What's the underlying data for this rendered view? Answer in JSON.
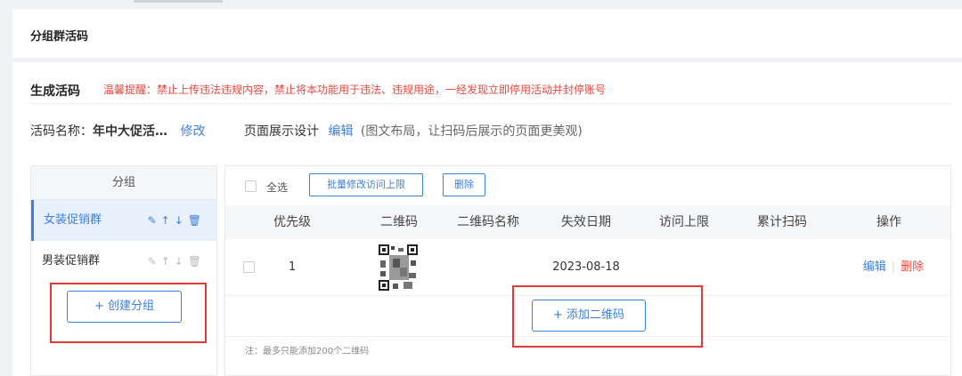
{
  "page": {
    "title": "分组群活码"
  },
  "section": {
    "title": "生成活码",
    "warning": "温馨提醒：禁止上传违法违规内容，禁止将本功能用于违法、违规用途，一经发现立即停用活动并封停账号"
  },
  "info": {
    "name_label": "活码名称：",
    "name_value": "年中大促活…",
    "modify_link": "修改",
    "design_label": "页面展示设计",
    "edit_link": "编辑",
    "design_hint": "(图文布局，让扫码后展示的页面更美观)"
  },
  "sidebar": {
    "header": "分组",
    "items": [
      {
        "label": "女装促销群",
        "active": true
      },
      {
        "label": "男装促销群",
        "active": false
      }
    ],
    "create_button": "+ 创建分组"
  },
  "toolbar": {
    "select_all": "全选",
    "batch_button": "批量修改访问上限",
    "delete_button": "删除"
  },
  "table": {
    "columns": [
      "优先级",
      "二维码",
      "二维码名称",
      "失效日期",
      "访问上限",
      "累计扫码",
      "操作"
    ],
    "rows": [
      {
        "priority": "1",
        "qr_name": "",
        "expire_date": "2023-08-18",
        "visit_limit": "",
        "total_scans": "",
        "action_edit": "编辑",
        "action_delete": "删除"
      }
    ],
    "add_button": "+ 添加二维码",
    "note": "注：最多只能添加200个二维码"
  },
  "colors": {
    "accent": "#3d7fdb",
    "warning": "#e5483f",
    "highlight_box": "#e53935"
  },
  "icons": {
    "sidebar_actions": [
      "edit-icon",
      "move-up-icon",
      "move-down-icon",
      "trash-icon"
    ]
  }
}
